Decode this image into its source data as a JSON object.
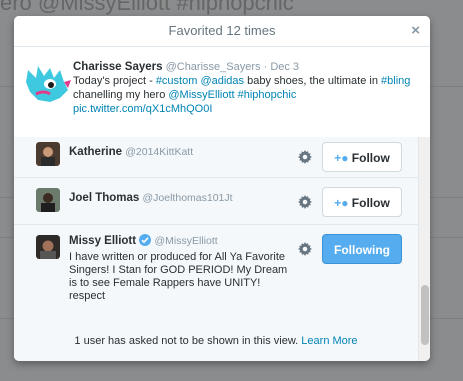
{
  "background": {
    "text": "ero @MissyElliott #hiphopchic"
  },
  "modal": {
    "title": "Favorited 12 times",
    "close_glyph": "×"
  },
  "tweet": {
    "author_name": "Charisse Sayers",
    "author_handle": "@Charisse_Sayers",
    "separator": "·",
    "date": "Dec 3",
    "text_prefix": "Today's project - ",
    "hashtag_custom": "#custom",
    "mention_adidas": "@adidas",
    "text_mid": " baby shoes, the ultimate in ",
    "hashtag_bling": "#bling",
    "text_channel": "chanelling my hero ",
    "mention_missy": "@MissyElliott",
    "hashtag_hiphopchic": "#hiphopchic",
    "pic_link": "pic.twitter.com/qX1cMhQO0I",
    "avatar_colors": {
      "primary": "#3ec9e0",
      "accent": "#e23a8c",
      "eye": "#1b1b1b"
    }
  },
  "users": [
    {
      "name": "Katherine",
      "handle": "@2014KittKatt",
      "button_label": "Follow",
      "button_state": "follow",
      "gear_icon": "gear-icon"
    },
    {
      "name": "Joel Thomas",
      "handle": "@Joelthomas101Jt",
      "button_label": "Follow",
      "button_state": "follow",
      "gear_icon": "gear-icon"
    },
    {
      "name": "Missy Elliott",
      "handle": "@MissyElliott",
      "verified": true,
      "bio": "I have written or produced for All Ya Favorite Singers! I Stan for GOD PERIOD! My Dream is to see Female Rappers have UNITY! respect",
      "button_label": "Following",
      "button_state": "following",
      "gear_icon": "gear-icon"
    }
  ],
  "footer": {
    "text": "1 user has asked not to be shown in this view.",
    "link": "Learn More"
  },
  "colors": {
    "link": "#0084b4",
    "following_blue": "#55acee",
    "muted": "#8899a6"
  }
}
